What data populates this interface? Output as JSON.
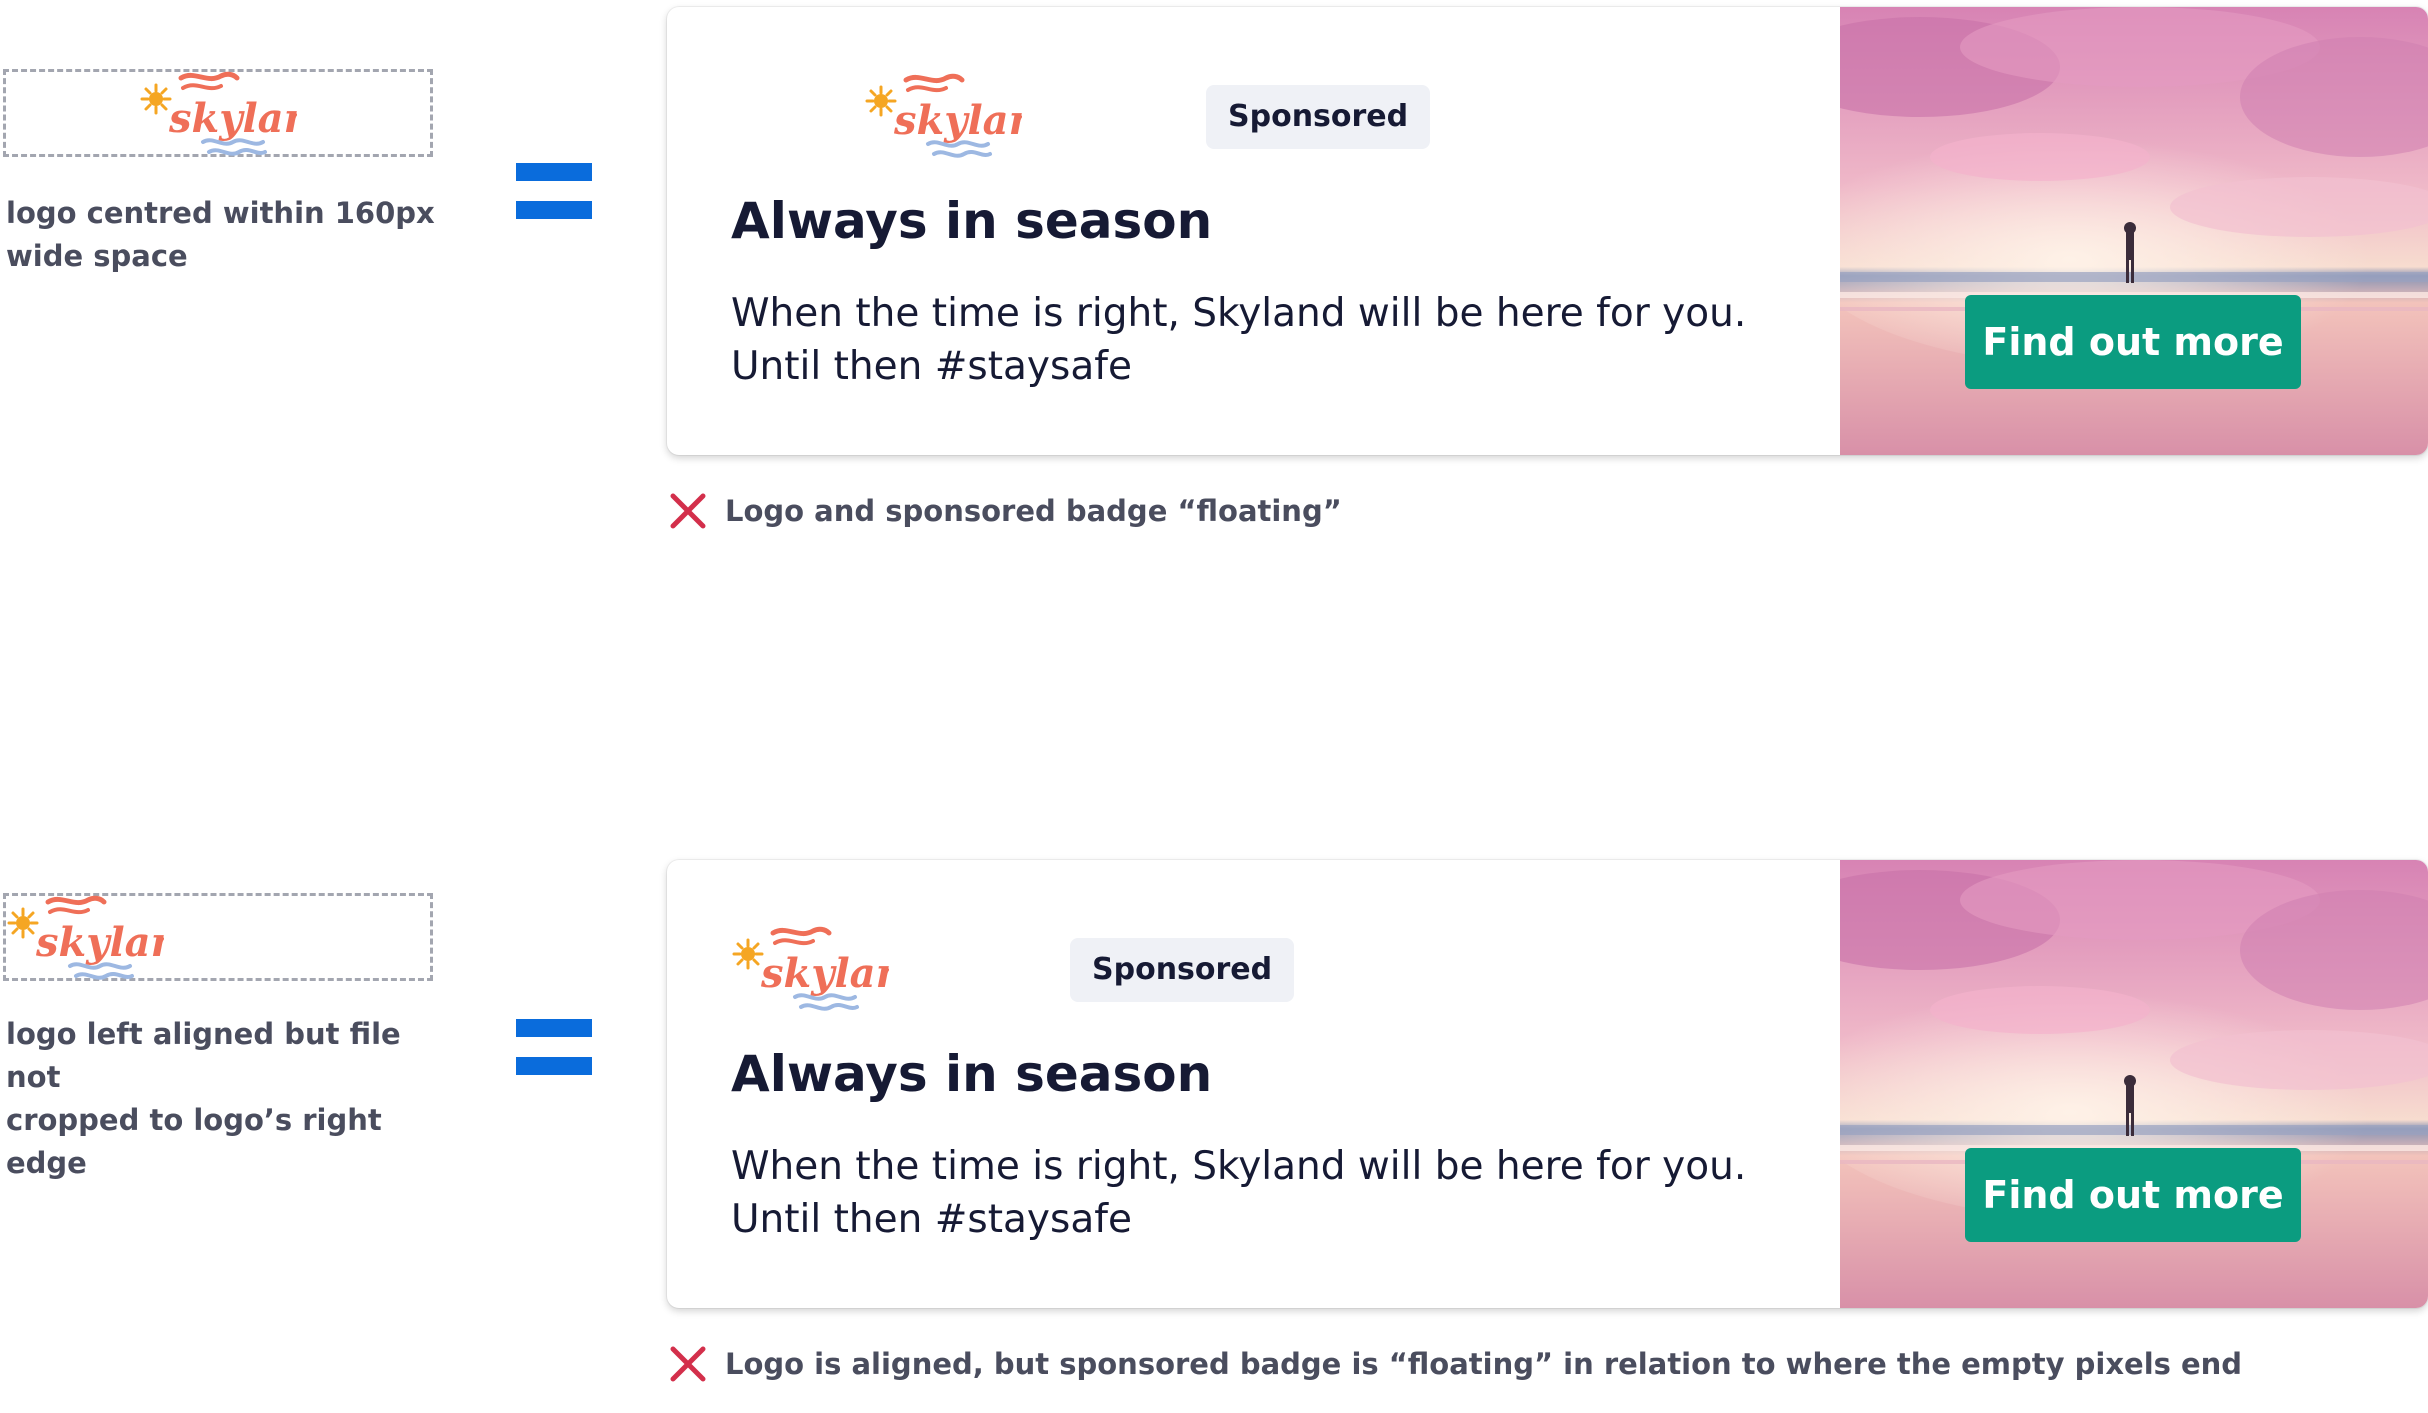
{
  "examples": [
    {
      "caption": "logo centred within 160px\nwide space",
      "ad": {
        "sponsored": "Sponsored",
        "headline": "Always in season",
        "body": "When the time is right, Skyland will be here for you.\nUntil then #staysafe",
        "cta": "Find out more"
      },
      "note": {
        "icon": "cross-icon",
        "text": "Logo and sponsored badge “floating”"
      }
    },
    {
      "caption": "logo left aligned but file not\ncropped to logo’s right edge",
      "ad": {
        "sponsored": "Sponsored",
        "headline": "Always in season",
        "body": "When the time is right, Skyland will be here for you.\nUntil then #staysafe",
        "cta": "Find out more"
      },
      "note": {
        "icon": "cross-icon",
        "text": "Logo is aligned, but sponsored badge is “floating” in relation to where the empty pixels end"
      }
    }
  ],
  "colors": {
    "equals_blue": "#0a6cdc",
    "cta_green": "#0b9c80",
    "cross_red": "#d32f4b",
    "logo_coral": "#ef6f58",
    "logo_sun": "#f5a623",
    "logo_wave": "#9db8e2"
  }
}
